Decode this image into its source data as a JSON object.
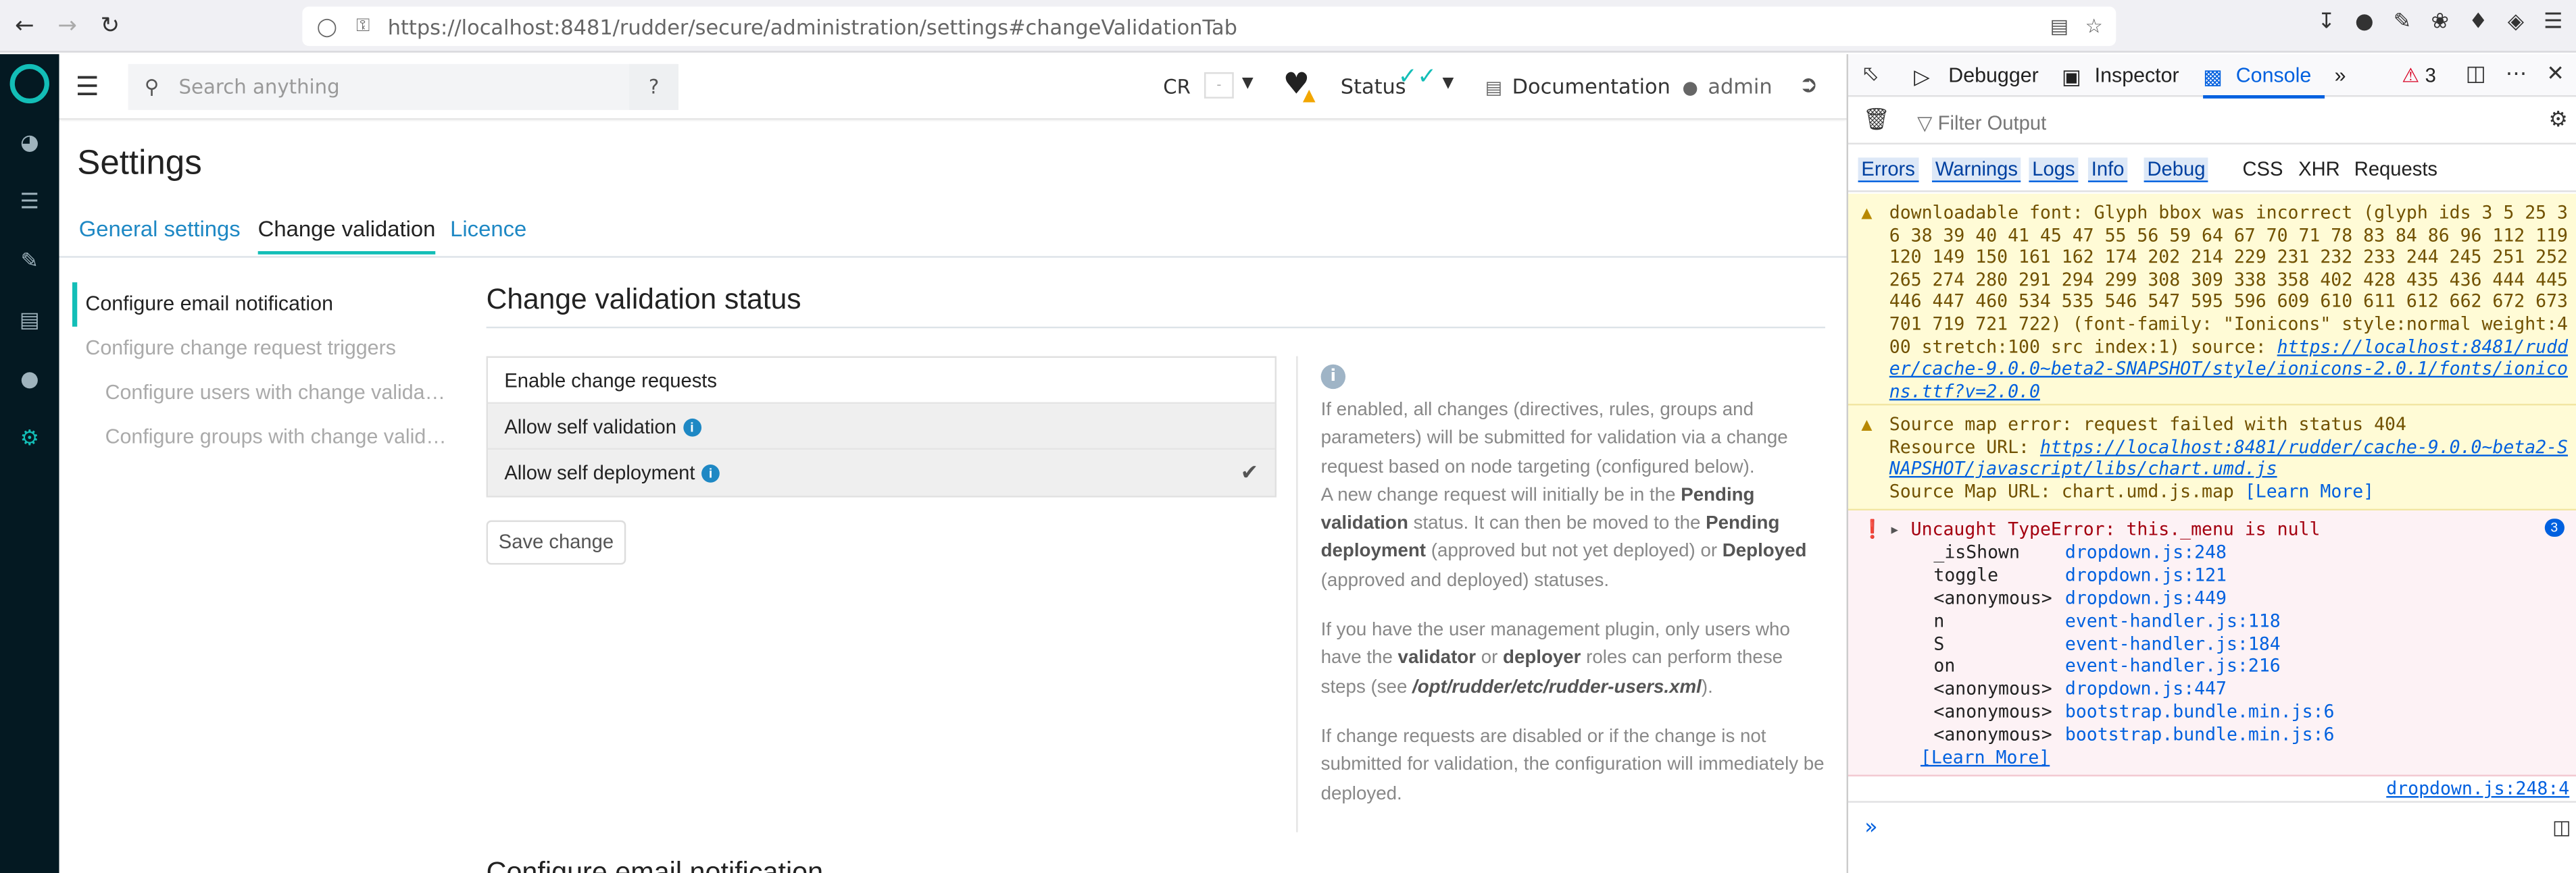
{
  "browser": {
    "url": "https://localhost:8481/rudder/secure/administration/settings#changeValidationTab"
  },
  "topbar": {
    "search_placeholder": "Search anything",
    "cr_label": "CR",
    "cr_value": "-",
    "status_label": "Status",
    "documentation_label": "Documentation",
    "user_label": "admin"
  },
  "page": {
    "title": "Settings",
    "tabs": [
      {
        "label": "General settings"
      },
      {
        "label": "Change validation"
      },
      {
        "label": "Licence"
      }
    ],
    "leftnav": [
      {
        "label": "Configure email notification"
      },
      {
        "label": "Configure change request triggers"
      },
      {
        "label": "Configure users with change validation"
      },
      {
        "label": "Configure groups with change validation"
      }
    ],
    "section_title": "Change validation status",
    "options": [
      {
        "label": "Enable change requests"
      },
      {
        "label": "Allow self validation"
      },
      {
        "label": "Allow self deployment"
      }
    ],
    "save_label": "Save change",
    "info": {
      "p1_a": "If enabled, all changes (directives, rules, groups and parameters) will be submitted for validation via a change request based on node targeting (configured below).",
      "p1_b": "A new change request will initially be in the ",
      "pending_validation": "Pending validation",
      "p1_c": " status. It can then be moved to the ",
      "pending_deployment": "Pending deployment",
      "p1_d": " (approved but not yet deployed) or ",
      "deployed": "Deployed",
      "p1_e": " (approved and deployed) statuses.",
      "p2_a": "If you have the user management plugin, only users who have the ",
      "validator": "validator",
      "p2_b": " or ",
      "deployer": "deployer",
      "p2_c": " roles can perform these steps (see ",
      "path": "/opt/rudder/etc/rudder-users.xml",
      "p2_d": ").",
      "p3": "If change requests are disabled or if the change is not submitted for validation, the configuration will immediately be deployed."
    },
    "next_section_title": "Configure email notification"
  },
  "devtools": {
    "tabs": {
      "debugger": "Debugger",
      "inspector": "Inspector",
      "console": "Console"
    },
    "error_count": "3",
    "filter_placeholder": "Filter Output",
    "levels": [
      "Errors",
      "Warnings",
      "Logs",
      "Info",
      "Debug"
    ],
    "types": [
      "CSS",
      "XHR",
      "Requests"
    ],
    "warn1": "downloadable font: Glyph bbox was incorrect (glyph ids 3 5 25 36 38 39 40 41 45 47 55 56 59 64 67 70 71 78 83 84 86 96 112 119 120 149 150 161 162 174 202 214 229 231 232 233 244 245 251 252 265 274 280 291 294 299 308 309 338 358 402 428 435 436 444 445 446 447 460 534 535 546 547 595 596 609 610 611 612 662 672 673 701 719 721 722) (font-family: \"Ionicons\" style:normal weight:400 stretch:100 src index:1) source: ",
    "warn1_link": "https://localhost:8481/rudder/cache-9.0.0~beta2-SNAPSHOT/style/ionicons-2.0.1/fonts/ionicons.ttf?v=2.0.0",
    "warn2": "Source map error: request failed with status 404",
    "warn2_res_label": "Resource URL: ",
    "warn2_res_link": "https://localhost:8481/rudder/cache-9.0.0~beta2-SNAPSHOT/javascript/libs/chart.umd.js",
    "warn2_map_label": "Source Map URL: chart.umd.js.map",
    "learn_more": "[Learn More]",
    "err_title": "Uncaught TypeError: this._menu is null",
    "err_badge": "3",
    "stack": [
      {
        "fn": "_isShown",
        "src": "dropdown.js:248"
      },
      {
        "fn": "toggle",
        "src": "dropdown.js:121"
      },
      {
        "fn": "<anonymous>",
        "src": "dropdown.js:449"
      },
      {
        "fn": "n",
        "src": "event-handler.js:118"
      },
      {
        "fn": "S",
        "src": "event-handler.js:184"
      },
      {
        "fn": "on",
        "src": "event-handler.js:216"
      },
      {
        "fn": "<anonymous>",
        "src": "dropdown.js:447"
      },
      {
        "fn": "<anonymous>",
        "src": "bootstrap.bundle.min.js:6"
      },
      {
        "fn": "<anonymous>",
        "src": "bootstrap.bundle.min.js:6"
      }
    ],
    "err_source": "dropdown.js:248:4",
    "prompt": "»"
  }
}
